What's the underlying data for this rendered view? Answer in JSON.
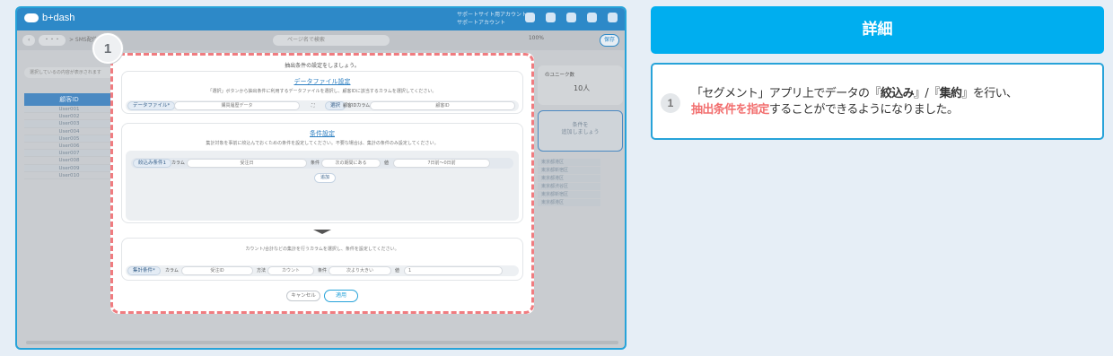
{
  "app": {
    "logo_text": "b+dash",
    "account_line1": "サポートサイト用アカウント",
    "account_line2": "サポートアカウント",
    "tab_back": "‹",
    "tab_more": "・・・",
    "tab_crumb": "> SMS配信",
    "search_placeholder": "ページ名で検索",
    "zoom": "100%",
    "save_label": "保存"
  },
  "background": {
    "filter_text": "選択しているの内容が表示されます",
    "column_header": "顧客ID",
    "rows": [
      "User001",
      "User002",
      "User003",
      "User004",
      "User005",
      "User006",
      "User007",
      "User008",
      "User009",
      "User010"
    ],
    "card_title": "のユニーク数",
    "card_value": "10人",
    "card2_line1": "条件を",
    "card2_line2": "追加しましょう",
    "list_items": [
      "東京都港区",
      "東京都新宿区",
      "東京都港区",
      "東京都渋谷区",
      "東京都新宿区",
      "東京都港区"
    ]
  },
  "modal": {
    "badge": "1",
    "title": "抽出条件の設定をしましょう。",
    "file_section": {
      "title": "データファイル設定",
      "desc": "「選択」ボタンから抽出条件に利用するデータファイルを選択し、顧客IDに該当するカラムを選択してください。",
      "file_label": "データファイル*",
      "file_value": "購買履歴データ",
      "select_btn": "選択",
      "id_col_label": "顧客IDカラム",
      "id_col_value": "顧客ID"
    },
    "condition_section": {
      "title": "条件設定",
      "desc": "集計対象を事前に絞込んでおくための条件を設定してください。不要な場合は、集計の条件のみ設定してください。",
      "filter_label": "絞込み条件1",
      "column_label": "カラム",
      "column_value": "受注日",
      "cond_label": "条件",
      "cond_value": "次の期間にある",
      "value_label": "値",
      "value_value": "7日前〜0日前",
      "add_btn": "追加"
    },
    "aggregate_section": {
      "desc": "カウント/合計などの集計を行うカラムを選択し、条件を設定してください。",
      "agg_label": "集計条件*",
      "column_label": "カラム",
      "column_value": "受注ID",
      "method_label": "方法",
      "method_value": "カウント",
      "cond_label": "条件",
      "cond_value": "次より大きい",
      "value_label": "値",
      "value_value": "1"
    },
    "cancel_btn": "キャンセル",
    "apply_btn": "適用"
  },
  "detail": {
    "heading": "詳細",
    "item_number": "1",
    "text_pre": "「セグメント」アプリ上でデータの『",
    "text_bold1": "絞込み",
    "text_mid1": "』/『",
    "text_bold2": "集約",
    "text_mid2": "』を行い、",
    "text_highlight": "抽出条件を指定",
    "text_post": "することができるようになりました。"
  },
  "colors": {
    "accent": "#00aeef",
    "highlight": "#f26f6f",
    "dash_border": "#f07c80"
  }
}
